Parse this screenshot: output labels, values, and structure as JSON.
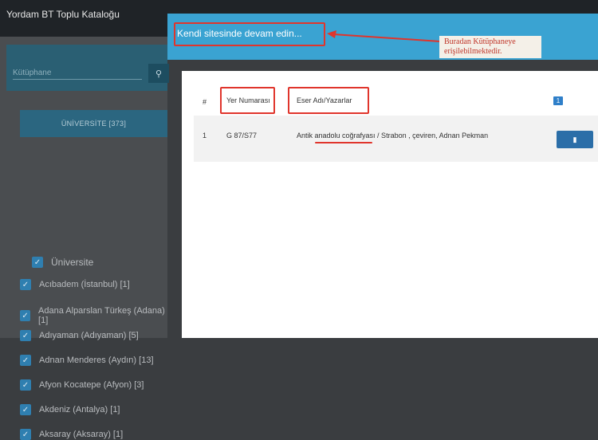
{
  "app": {
    "title": "Yordam BT Toplu Kataloğu"
  },
  "sidebar": {
    "search_placeholder": "Kütüphane",
    "search_icon": "search-icon",
    "category_button": "ÜNİVERSİTE [373]",
    "group_label": "Üniversite",
    "items": [
      {
        "label": "Acıbadem (İstanbul) [1]",
        "checked": true
      },
      {
        "label": "Adana Alparslan Türkeş (Adana) [1]",
        "checked": true
      },
      {
        "label": "Adıyaman (Adıyaman) [5]",
        "checked": true
      },
      {
        "label": "Adnan Menderes (Aydın) [13]",
        "checked": true
      },
      {
        "label": "Afyon Kocatepe (Afyon) [3]",
        "checked": true
      },
      {
        "label": "Akdeniz (Antalya) [1]",
        "checked": true
      },
      {
        "label": "Aksaray (Aksaray) [1]",
        "checked": true
      }
    ]
  },
  "modal": {
    "header_link": "Kendi sitesinde devam edin...",
    "callout_text": "Buradan Kütüphaneye erişilebilmektedir.",
    "columns": {
      "number": "#",
      "call_number": "Yer Numarası",
      "title_authors": "Eser Adı/Yazarlar"
    },
    "badge": "1",
    "rows": [
      {
        "number": "1",
        "call_number": "G 87/S77",
        "title_authors": "Antik anadolu coğrafyası / Strabon , çeviren, Adnan Pekman"
      }
    ],
    "detail_icon": "document-icon"
  },
  "colors": {
    "header_blue": "#3aa3d2",
    "annotation_red": "#e0352c",
    "sidebar_teal": "#2a5f73"
  }
}
